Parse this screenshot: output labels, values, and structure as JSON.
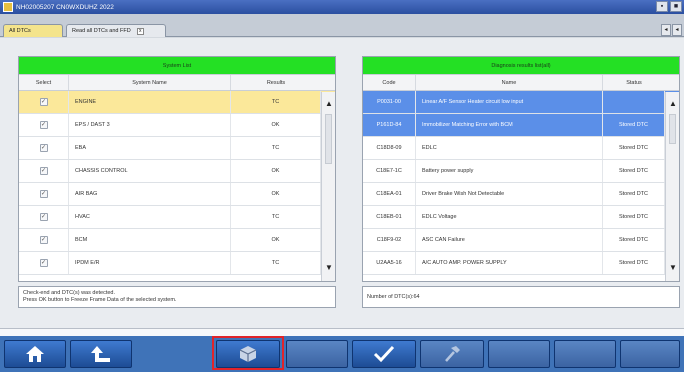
{
  "window": {
    "title": "NH02005207  CN0WXDUHZ 2022"
  },
  "window_controls": [
    "▪",
    "■"
  ],
  "tabs": [
    {
      "label": "All DTCs",
      "active": true
    },
    {
      "label": "Read all DTCs and FFD",
      "active": false,
      "close": "x"
    }
  ],
  "tab_arrows": [
    "◂",
    "◂"
  ],
  "system_list": {
    "title": "System List",
    "columns": [
      "Select",
      "System Name",
      "Results"
    ],
    "rows": [
      {
        "check": "✓",
        "name": "ENGINE",
        "result": "TC"
      },
      {
        "check": "✓",
        "name": "EPS / DAST 3",
        "result": "OK"
      },
      {
        "check": "✓",
        "name": "EBA",
        "result": "TC"
      },
      {
        "check": "✓",
        "name": "CHASSIS CONTROL",
        "result": "OK"
      },
      {
        "check": "✓",
        "name": "AIR BAG",
        "result": "OK"
      },
      {
        "check": "✓",
        "name": "HVAC",
        "result": "TC"
      },
      {
        "check": "✓",
        "name": "BCM",
        "result": "OK"
      },
      {
        "check": "✓",
        "name": "IPDM E/R",
        "result": "TC"
      }
    ],
    "scroll_up": "▲",
    "scroll_down": "▼"
  },
  "diagnosis_results": {
    "title": "Diagnosis results list(all)",
    "columns": [
      "Code",
      "Name",
      "Status"
    ],
    "rows": [
      {
        "code": "P0031-00",
        "name": "Linear A/F Sensor Heater circuit low input",
        "status": ""
      },
      {
        "code": "P161D-84",
        "name": "Immobilizer Matching Error with BCM",
        "status": "Stored DTC"
      },
      {
        "code": "C18D8-09",
        "name": "EDLC",
        "status": "Stored DTC"
      },
      {
        "code": "C18E7-1C",
        "name": "Battery power supply",
        "status": "Stored DTC"
      },
      {
        "code": "C18EA-01",
        "name": "Driver Brake Wish Not Detectable",
        "status": "Stored DTC"
      },
      {
        "code": "C18EB-01",
        "name": "EDLC Voltage",
        "status": "Stored DTC"
      },
      {
        "code": "C18F9-02",
        "name": "ASC CAN Failure",
        "status": "Stored DTC"
      },
      {
        "code": "U2AA5-16",
        "name": "A/C AUTO AMP. POWER SUPPLY",
        "status": "Stored DTC"
      }
    ],
    "scroll_up": "▲",
    "scroll_down": "▼"
  },
  "messages": {
    "left_line1": "Check-end and DTC(s) was detected.",
    "left_line2": "Press OK button to Freeze Frame Data of the selected system.",
    "right": "Number of DTC(s):64"
  },
  "colors": {
    "accent_green": "#24e024",
    "select_yellow": "#fbe89a",
    "select_blue": "#5b8fe8",
    "toolbar_blue": "#3f73b8",
    "highlight_red": "#e0242a"
  }
}
